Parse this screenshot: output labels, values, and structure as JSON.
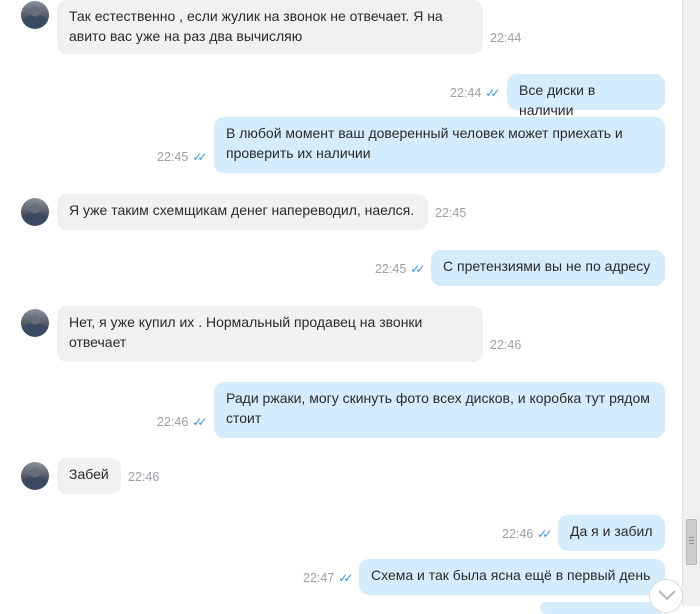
{
  "messages": [
    {
      "direction": "in",
      "text": "Так естественно , если жулик на звонок не отвечает. Я на авито вас уже на раз два вычисляю",
      "time": "22:44"
    },
    {
      "direction": "out",
      "text": "Все диски в наличии",
      "time": "22:44"
    },
    {
      "direction": "out",
      "text": "В любой момент ваш доверенный человек может приехать и проверить их наличии",
      "time": "22:45"
    },
    {
      "direction": "in",
      "text": "Я уже таким схемщикам денег напереводил, наелся.",
      "time": "22:45"
    },
    {
      "direction": "out",
      "text": "С претензиями вы не по адресу",
      "time": "22:45"
    },
    {
      "direction": "in",
      "text": "Нет, я уже купил их . Нормальный продавец на звонки отвечает",
      "time": "22:46"
    },
    {
      "direction": "out",
      "text": "Ради ржаки, могу скинуть фото всех дисков, и коробка тут рядом стоит",
      "time": "22:46"
    },
    {
      "direction": "in",
      "text": "Забей",
      "time": "22:46"
    },
    {
      "direction": "out",
      "text": "Да я и забил",
      "time": "22:46"
    },
    {
      "direction": "out",
      "text": "Схема и так была ясна ещё в первый день",
      "time": "22:47"
    }
  ],
  "read_ticks": "✓✓",
  "icons": {
    "avatar": "user-avatar",
    "read": "double-check-icon",
    "scroll": "chevron-down-icon"
  },
  "colors": {
    "incoming_bubble": "#f1f1f1",
    "outgoing_bubble": "#d4ecfb",
    "tick": "#3d96d8",
    "time": "#9aa0a6"
  }
}
